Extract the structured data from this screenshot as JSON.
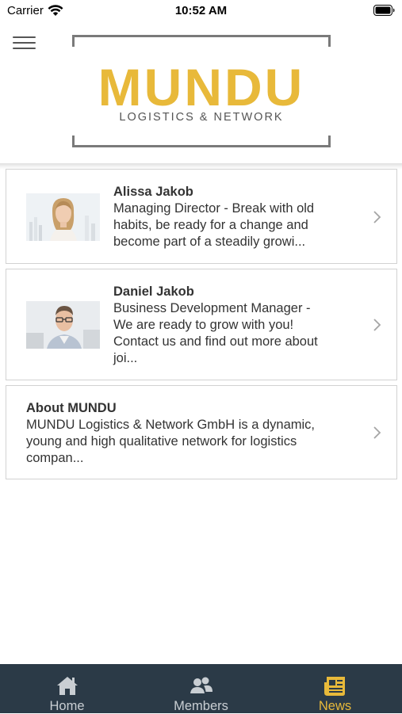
{
  "status_bar": {
    "carrier": "Carrier",
    "time": "10:52 AM"
  },
  "header": {
    "logo_title": "MUNDU",
    "logo_subtitle": "LOGISTICS & NETWORK",
    "accent_color": "#e8b93a"
  },
  "cards": [
    {
      "name": "Alissa Jakob",
      "desc_lines": [
        "Managing Director - Break with old",
        "habits, be ready for a change and",
        "become part of a steadily growi..."
      ],
      "has_photo": true
    },
    {
      "name": "Daniel Jakob",
      "desc_lines": [
        "Business Development Manager -",
        "We are ready to grow with you!",
        "Contact us and find out more about",
        "joi..."
      ],
      "has_photo": true
    },
    {
      "name": "About MUNDU",
      "desc_lines": [
        "MUNDU Logistics & Network GmbH is a dynamic,",
        "young and high qualitative network for logistics",
        "compan..."
      ],
      "has_photo": false
    }
  ],
  "tab_bar": {
    "background": "#2b3a47",
    "active_color": "#e8b93a",
    "tabs": [
      {
        "label": "Home",
        "icon": "home-icon",
        "active": false
      },
      {
        "label": "Members",
        "icon": "members-icon",
        "active": false
      },
      {
        "label": "News",
        "icon": "news-icon",
        "active": true
      }
    ]
  }
}
